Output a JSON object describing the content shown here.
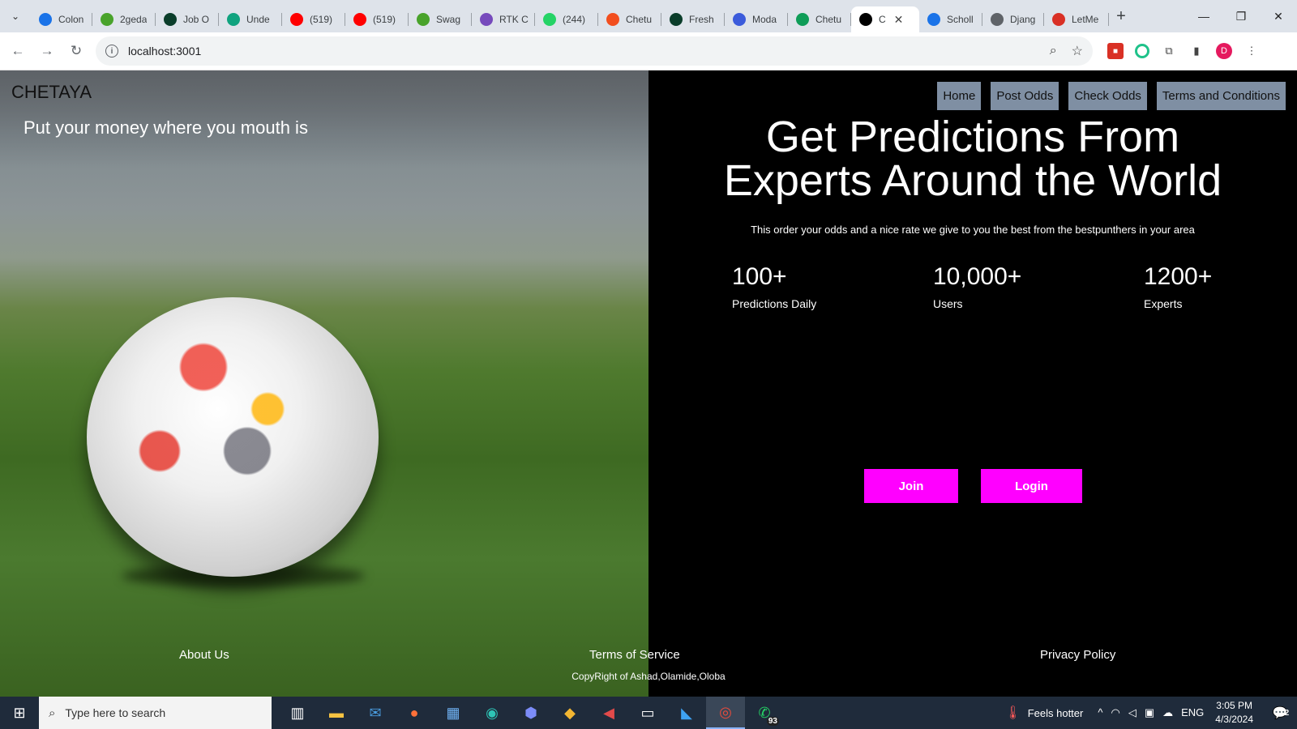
{
  "browser": {
    "tabs": [
      {
        "title": "Colon",
        "icon": "globe-icon",
        "color": "#1a73e8"
      },
      {
        "title": "2geda",
        "icon": "swagger-icon",
        "color": "#49a32b"
      },
      {
        "title": "Job O",
        "icon": "ir-icon",
        "color": "#0a3d2a"
      },
      {
        "title": "Unde",
        "icon": "openai-icon",
        "color": "#10a37f"
      },
      {
        "title": "(519)",
        "icon": "youtube-icon",
        "color": "#ff0000"
      },
      {
        "title": "(519)",
        "icon": "youtube-icon",
        "color": "#ff0000"
      },
      {
        "title": "Swag",
        "icon": "swagger-icon",
        "color": "#49a32b"
      },
      {
        "title": "RTK C",
        "icon": "redux-icon",
        "color": "#764abc"
      },
      {
        "title": "(244)",
        "icon": "whatsapp-icon",
        "color": "#25d366"
      },
      {
        "title": "Chetu",
        "icon": "figma-icon",
        "color": "#f24e1e"
      },
      {
        "title": "Fresh",
        "icon": "ir-icon",
        "color": "#0a3d2a"
      },
      {
        "title": "Moda",
        "icon": "diamond-icon",
        "color": "#3b5bdb"
      },
      {
        "title": "Chetu",
        "icon": "sheets-icon",
        "color": "#0f9d58"
      },
      {
        "title": "C",
        "icon": "vercel-icon",
        "color": "#000000",
        "active": true
      },
      {
        "title": "Scholl",
        "icon": "cap-icon",
        "color": "#1a73e8"
      },
      {
        "title": "Djang",
        "icon": "globe-icon",
        "color": "#5f6368"
      },
      {
        "title": "LetMe",
        "icon": "letme-icon",
        "color": "#d93025"
      }
    ],
    "url": "localhost:3001",
    "profile_initial": "D"
  },
  "page": {
    "brand": "CHETAYA",
    "tagline": "Put your money where you mouth is",
    "nav": [
      "Home",
      "Post Odds",
      "Check Odds",
      "Terms and Conditions"
    ],
    "headline_line1": "Get Predictions From",
    "headline_line2": "Experts Around the World",
    "subtext": "This order your odds and a nice rate we give to you the best from the bestpunthers in your area",
    "stats": [
      {
        "value": "100+",
        "label": "Predictions Daily"
      },
      {
        "value": "10,000+",
        "label": "Users"
      },
      {
        "value": "1200+",
        "label": "Experts"
      }
    ],
    "join_label": "Join",
    "login_label": "Login",
    "footer": {
      "about": "About Us",
      "terms": "Terms of Service",
      "privacy": "Privacy Policy",
      "copyright": "CopyRight of Ashad,Olamide,Oloba"
    },
    "accent_color": "#ff00ff"
  },
  "taskbar": {
    "search_placeholder": "Type here to search",
    "weather": "Feels hotter",
    "lang": "ENG",
    "time": "3:05 PM",
    "date": "4/3/2024",
    "notification_count": "2",
    "whatsapp_badge": "93"
  }
}
